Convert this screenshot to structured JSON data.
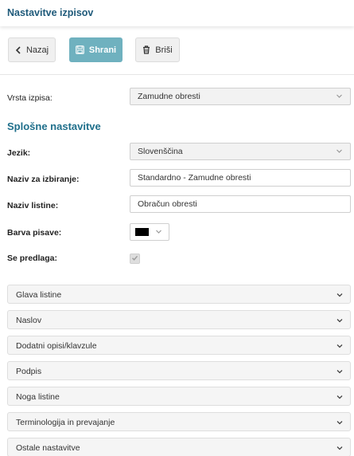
{
  "header": {
    "title": "Nastavitve izpisov"
  },
  "toolbar": {
    "back_label": "Nazaj",
    "save_label": "Shrani",
    "delete_label": "Briši"
  },
  "form": {
    "doc_type": {
      "label": "Vrsta izpisa:",
      "value": "Zamudne obresti"
    },
    "section_title": "Splošne nastavitve",
    "language": {
      "label": "Jezik:",
      "value": "Slovenščina"
    },
    "selection_name": {
      "label": "Naziv za izbiranje:",
      "value": "Standardno - Zamudne obresti"
    },
    "document_name": {
      "label": "Naziv listine:",
      "value": "Obračun obresti"
    },
    "font_color": {
      "label": "Barva pisave:",
      "value": "#000000"
    },
    "template": {
      "label": "Se predlaga:",
      "checked": true
    }
  },
  "accordion": [
    {
      "label": "Glava listine"
    },
    {
      "label": "Naslov"
    },
    {
      "label": "Dodatni opisi/klavzule"
    },
    {
      "label": "Podpis"
    },
    {
      "label": "Noga listine"
    },
    {
      "label": "Terminologija in prevajanje"
    },
    {
      "label": "Ostale nastavitve"
    }
  ],
  "colors": {
    "accent": "#1f6f8b",
    "save_button": "#6fb1bf"
  },
  "icons": {
    "back": "chevron-left-icon",
    "save": "save-icon",
    "delete": "trash-icon",
    "caret": "chevron-down-icon",
    "check": "check-icon"
  }
}
